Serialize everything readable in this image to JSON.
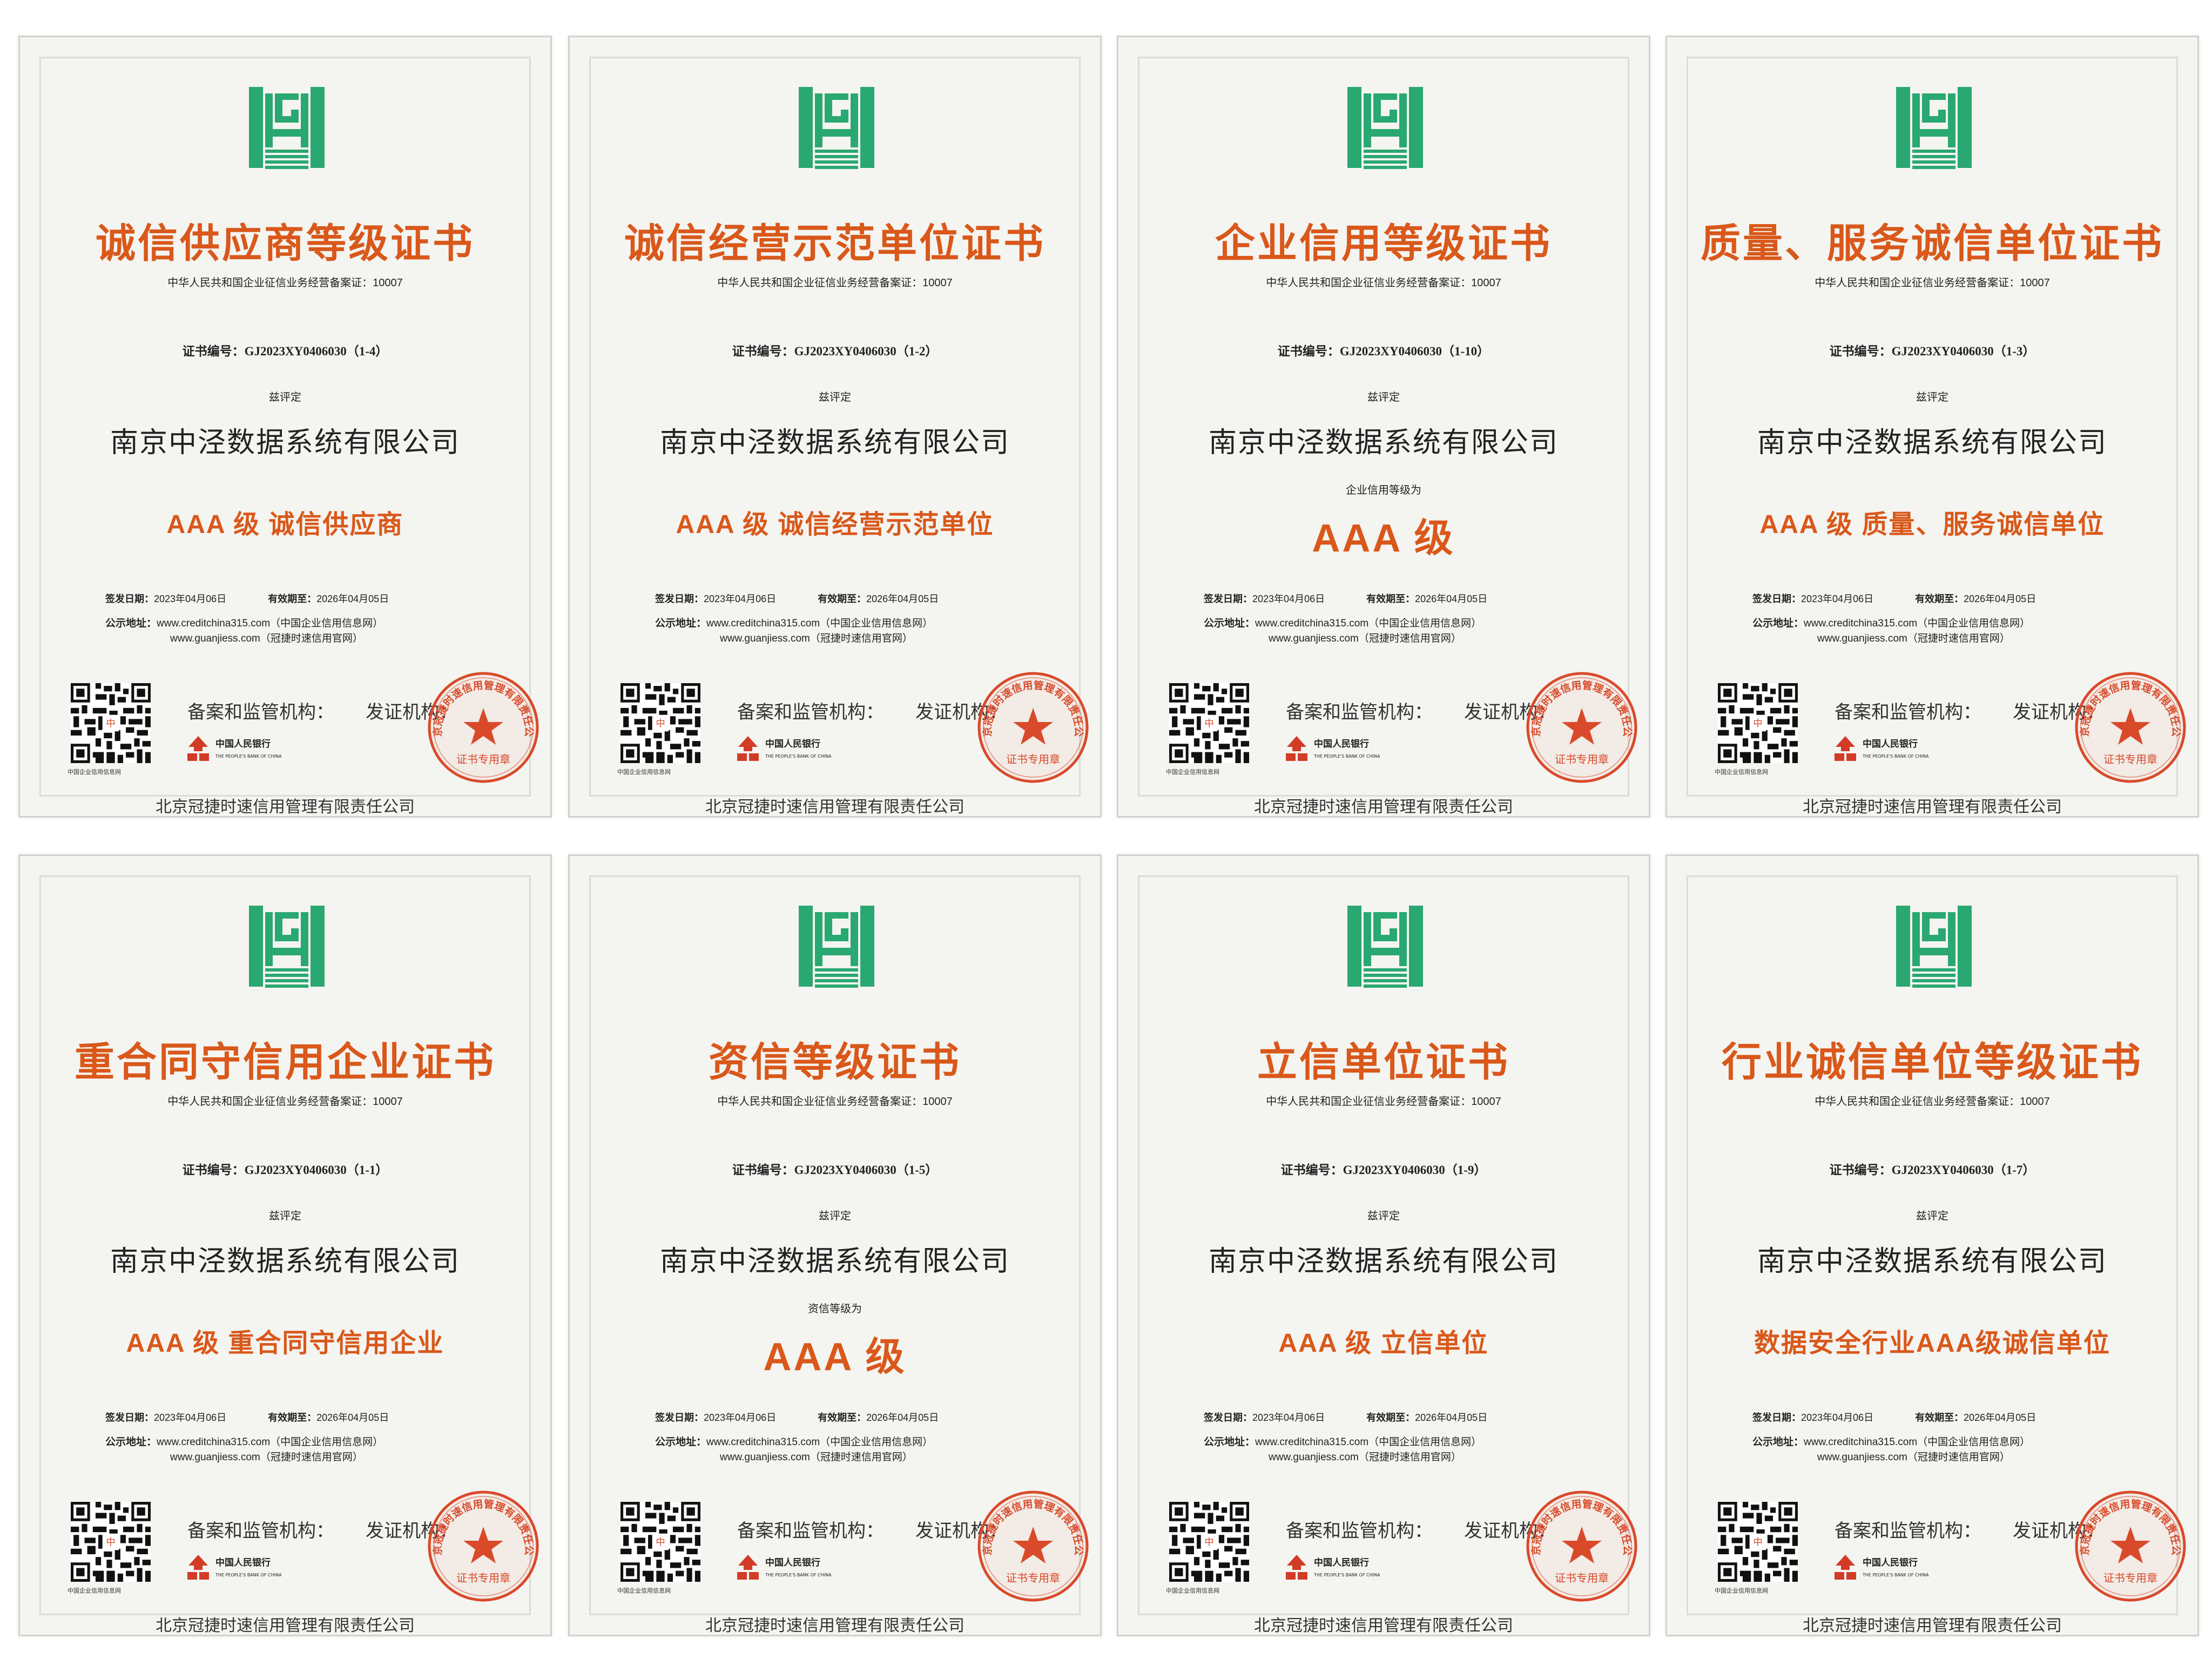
{
  "common": {
    "license": "中华人民共和国企业征信业务经营备案证：10007",
    "evaluated_label": "兹评定",
    "company": "南京中泾数据系统有限公司",
    "issue_date_label": "签发日期：",
    "issue_date": "2023年04月06日",
    "expiry_label": "有效期至：",
    "expiry_date": "2026年04月05日",
    "url_label": "公示地址：",
    "url_1": "www.creditchina315.com（中国企业信用信息网）",
    "url_2": "www.guanjiess.com（冠捷时速信用官网）",
    "qr_caption": "中国企业信用信息网",
    "regulator_label": "备案和监管机构：",
    "issuer_label": "发证机构：",
    "pboc_name": "中国人民银行",
    "pboc_en": "THE PEOPLE'S BANK OF CHINA",
    "seal_text": "北京冠捷时速信用管理有限责任公司",
    "seal_center": "证书专用章",
    "issuer": "北京冠捷时速信用管理有限责任公司"
  },
  "certificates": [
    {
      "title": "诚信供应商等级证书",
      "cert_no": "证书编号：GJ2023XY0406030（1-4）",
      "level_note": "",
      "level": "AAA 级  诚信供应商"
    },
    {
      "title": "诚信经营示范单位证书",
      "cert_no": "证书编号：GJ2023XY0406030（1-2）",
      "level_note": "",
      "level": "AAA 级  诚信经营示范单位"
    },
    {
      "title": "企业信用等级证书",
      "cert_no": "证书编号：GJ2023XY0406030（1-10）",
      "level_note": "企业信用等级为",
      "level": "AAA 级"
    },
    {
      "title": "质量、服务诚信单位证书",
      "cert_no": "证书编号：GJ2023XY0406030（1-3）",
      "level_note": "",
      "level": "AAA 级  质量、服务诚信单位"
    },
    {
      "title": "重合同守信用企业证书",
      "cert_no": "证书编号：GJ2023XY0406030（1-1）",
      "level_note": "",
      "level": "AAA 级  重合同守信用企业"
    },
    {
      "title": "资信等级证书",
      "cert_no": "证书编号：GJ2023XY0406030（1-5）",
      "level_note": "资信等级为",
      "level": "AAA 级"
    },
    {
      "title": "立信单位证书",
      "cert_no": "证书编号：GJ2023XY0406030（1-9）",
      "level_note": "",
      "level": "AAA 级  立信单位"
    },
    {
      "title": "行业诚信单位等级证书",
      "cert_no": "证书编号：GJ2023XY0406030（1-7）",
      "level_note": "",
      "level": "数据安全行业AAA级诚信单位"
    }
  ],
  "colors": {
    "title": "#d9581a",
    "logo_green": "#2aa872",
    "seal_red": "#d94a2a"
  }
}
